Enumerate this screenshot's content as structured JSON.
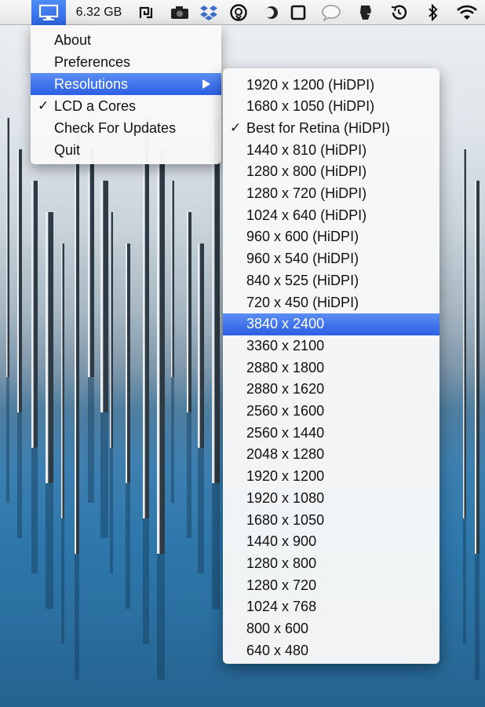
{
  "menubar": {
    "memory": "6.32 GB",
    "icons": [
      "display-icon",
      "memory-text",
      "app-icon-bracket",
      "camera-icon",
      "dropbox-icon",
      "cs-icon",
      "moon-icon",
      "square-icon",
      "speech-bubble-icon",
      "evernote-icon",
      "time-machine-icon",
      "bluetooth-icon",
      "wifi-icon"
    ]
  },
  "menu": {
    "items": [
      {
        "label": "About",
        "checked": false,
        "submenu": false,
        "highlighted": false
      },
      {
        "label": "Preferences",
        "checked": false,
        "submenu": false,
        "highlighted": false
      },
      {
        "label": "Resolutions",
        "checked": false,
        "submenu": true,
        "highlighted": true
      },
      {
        "label": "LCD a Cores",
        "checked": true,
        "submenu": false,
        "highlighted": false
      },
      {
        "label": "Check For Updates",
        "checked": false,
        "submenu": false,
        "highlighted": false
      },
      {
        "label": "Quit",
        "checked": false,
        "submenu": false,
        "highlighted": false
      }
    ]
  },
  "resolutions": {
    "checked_index": 2,
    "highlighted_index": 11,
    "items": [
      "1920 x 1200 (HiDPI)",
      "1680 x 1050 (HiDPI)",
      "Best for Retina (HiDPI)",
      "1440 x 810 (HiDPI)",
      "1280 x 800 (HiDPI)",
      "1280 x 720 (HiDPI)",
      "1024 x 640 (HiDPI)",
      "960 x 600 (HiDPI)",
      "960 x 540 (HiDPI)",
      "840 x 525 (HiDPI)",
      "720 x 450 (HiDPI)",
      "3840 x 2400",
      "3360 x 2100",
      "2880 x 1800",
      "2880 x 1620",
      "2560 x 1600",
      "2560 x 1440",
      "2048 x 1280",
      "1920 x 1200",
      "1920 x 1080",
      "1680 x 1050",
      "1440 x 900",
      "1280 x 800",
      "1280 x 720",
      "1024 x 768",
      "800 x 600",
      "640 x 480"
    ]
  },
  "colors": {
    "highlight": "#3b6fe8",
    "menu_bg": "#f8f8f8",
    "lake": "#2f78ac"
  }
}
